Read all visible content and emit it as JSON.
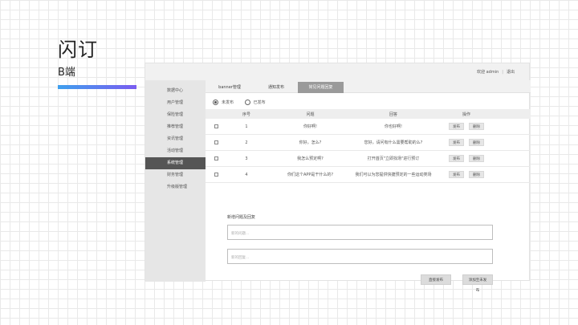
{
  "slide": {
    "title": "闪订",
    "subtitle": "B端",
    "accent_gradient": [
      "#3fa0ee",
      "#7a5cf0"
    ]
  },
  "topbar": {
    "welcome": "欢迎 admin",
    "logout": "退出"
  },
  "sidebar": {
    "items": [
      {
        "label": "数据中心"
      },
      {
        "label": "用户管理"
      },
      {
        "label": "保险管理"
      },
      {
        "label": "推荐管理"
      },
      {
        "label": "资讯管理"
      },
      {
        "label": "活动管理"
      },
      {
        "label": "系统管理"
      },
      {
        "label": "财务管理"
      },
      {
        "label": "升级版管理"
      }
    ],
    "active_index": 6
  },
  "tabs": [
    {
      "label": "banner管理"
    },
    {
      "label": "通知发布"
    },
    {
      "label": "常见问题回复"
    }
  ],
  "active_tab": 2,
  "filter": {
    "unpublished": "未发布",
    "published": "已发布",
    "selected": "unpublished"
  },
  "table": {
    "headers": [
      "序号",
      "问题",
      "回答",
      "操作"
    ],
    "rows": [
      {
        "num": "1",
        "question": "你好啊!",
        "answer": "你也好啊!",
        "publish": "发布",
        "delete": "删除"
      },
      {
        "num": "2",
        "question": "你好，怎么?",
        "answer": "您好，请问有什么需要帮助的么?",
        "publish": "发布",
        "delete": "删除"
      },
      {
        "num": "3",
        "question": "我怎么预定啊?",
        "answer": "打开首页\"立即找场\"进行预订",
        "publish": "发布",
        "delete": "删除"
      },
      {
        "num": "4",
        "question": "你们这个APP是干什么的?",
        "answer": "我们可以为您提供快捷预定的一些运动类场",
        "publish": "发布",
        "delete": "删除"
      }
    ]
  },
  "add_form": {
    "title": "新增问题及回复",
    "question_placeholder": "新的问题...",
    "answer_placeholder": "新的回复...",
    "save_button": "直接发布",
    "publish_button": "添加至未发布"
  }
}
